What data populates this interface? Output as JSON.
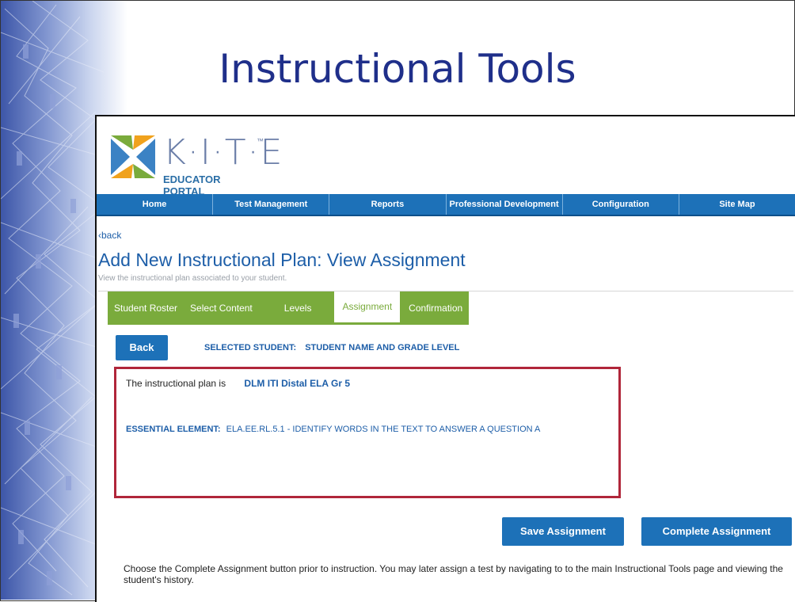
{
  "slide": {
    "title": "Instructional Tools"
  },
  "logo": {
    "wordmark": "K·I·T·E",
    "trademark": "™",
    "subtitle": "EDUCATOR PORTAL"
  },
  "nav": {
    "items": [
      "Home",
      "Test Management",
      "Reports",
      "Professional Development",
      "Configuration",
      "Site Map"
    ]
  },
  "page": {
    "back_link": "‹back",
    "title": "Add New Instructional Plan: View Assignment",
    "subtitle": "View the instructional plan associated to your student."
  },
  "tabs": {
    "items": [
      "Student Roster",
      "Select Content",
      "Levels",
      "Assignment",
      "Confirmation"
    ],
    "active": "Assignment"
  },
  "student": {
    "back_label": "Back",
    "selected_label": "SELECTED STUDENT:",
    "selected_value": "STUDENT NAME AND GRADE LEVEL"
  },
  "plan": {
    "intro": "The instructional plan is",
    "name": "DLM ITI Distal ELA Gr 5",
    "essential_label": "ESSENTIAL ELEMENT:",
    "essential_value": "ELA.EE.RL.5.1 - IDENTIFY WORDS IN THE TEXT TO ANSWER A QUESTION A"
  },
  "actions": {
    "save_label": "Save Assignment",
    "complete_label": "Complete Assignment"
  },
  "instructions": "Choose the Complete Assignment button prior to instruction. You may later assign a test by navigating to to the main Instructional Tools page and viewing the student's history.",
  "colors": {
    "nav_blue": "#1d71b8",
    "tab_green": "#7aab3c",
    "highlight_red": "#b0263a",
    "title_navy": "#1f2f8a"
  }
}
